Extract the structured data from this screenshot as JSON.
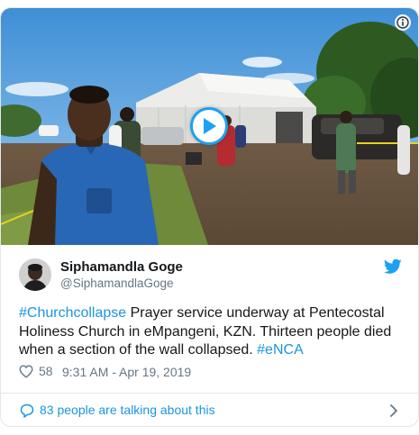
{
  "media": {
    "type": "video",
    "play_icon": "play-icon",
    "info_icon": "info-icon"
  },
  "author": {
    "display_name": "Siphamandla Goge",
    "handle": "@SiphamandlaGoge",
    "avatar_icon": "avatar"
  },
  "brand": {
    "icon": "twitter-bird-icon",
    "color": "#1da1f2"
  },
  "tweet": {
    "hashtag1": "#Churchcollapse",
    "body": " Prayer service underway at Pentecostal Holiness Church in eMpangeni, KZN. Thirteen people died when a section of the wall collapsed. ",
    "hashtag2": "#eNCA"
  },
  "meta": {
    "likes": "58",
    "timestamp": "9:31 AM - Apr 19, 2019"
  },
  "footer": {
    "talk_text": "83 people are talking about this"
  },
  "colors": {
    "link": "#1b95e0",
    "secondary_text": "#657786",
    "border": "#e1e8ed"
  }
}
